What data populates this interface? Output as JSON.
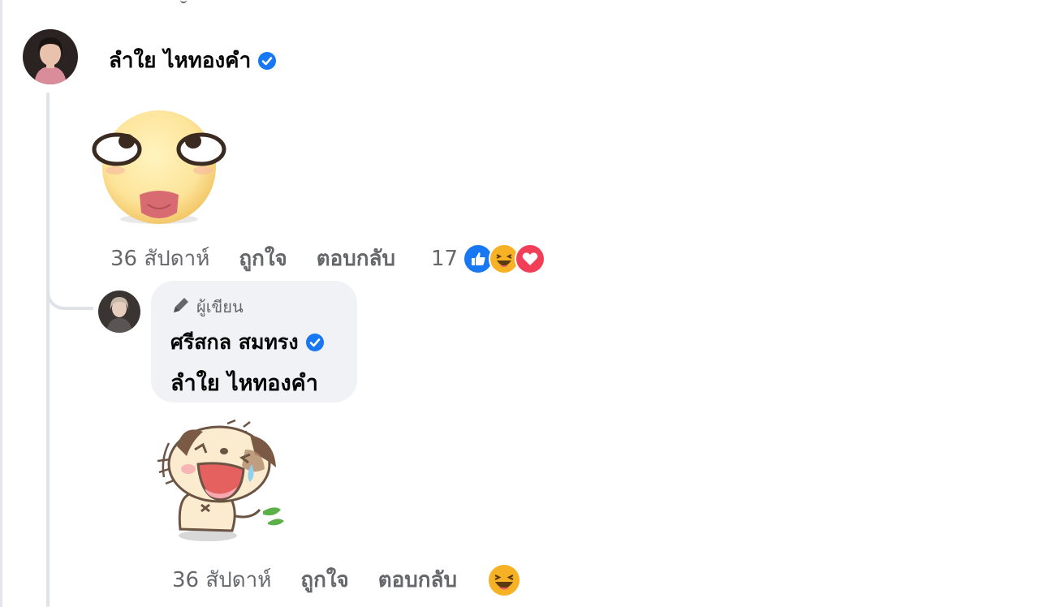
{
  "comment": {
    "author_name": "ลำใย ไหทองคำ",
    "verified": true,
    "sticker_icon": "rolling-eyes-tongue-emoji-sticker",
    "time": "36 สัปดาห์",
    "like_label": "ถูกใจ",
    "reply_label": "ตอบกลับ",
    "reaction_count": "17",
    "reactions": [
      "like",
      "haha",
      "love"
    ]
  },
  "reply": {
    "badge_label": "ผู้เขียน",
    "author_name": "ศรีสกล สมทรง",
    "verified": true,
    "text": "ลำใย ไหทองคำ",
    "sticker_icon": "laughing-puppy-sticker",
    "time": "36 สัปดาห์",
    "like_label": "ถูกใจ",
    "reply_label": "ตอบกลับ",
    "reactions": [
      "haha"
    ]
  },
  "colors": {
    "verified_blue": "#1877f2",
    "like_blue": "#1877f2",
    "love_red": "#f33e58",
    "haha_yellow": "#f7b125",
    "muted_text": "#65676b",
    "bubble_bg": "#f0f2f5",
    "thread_line": "#dfe3e8"
  }
}
